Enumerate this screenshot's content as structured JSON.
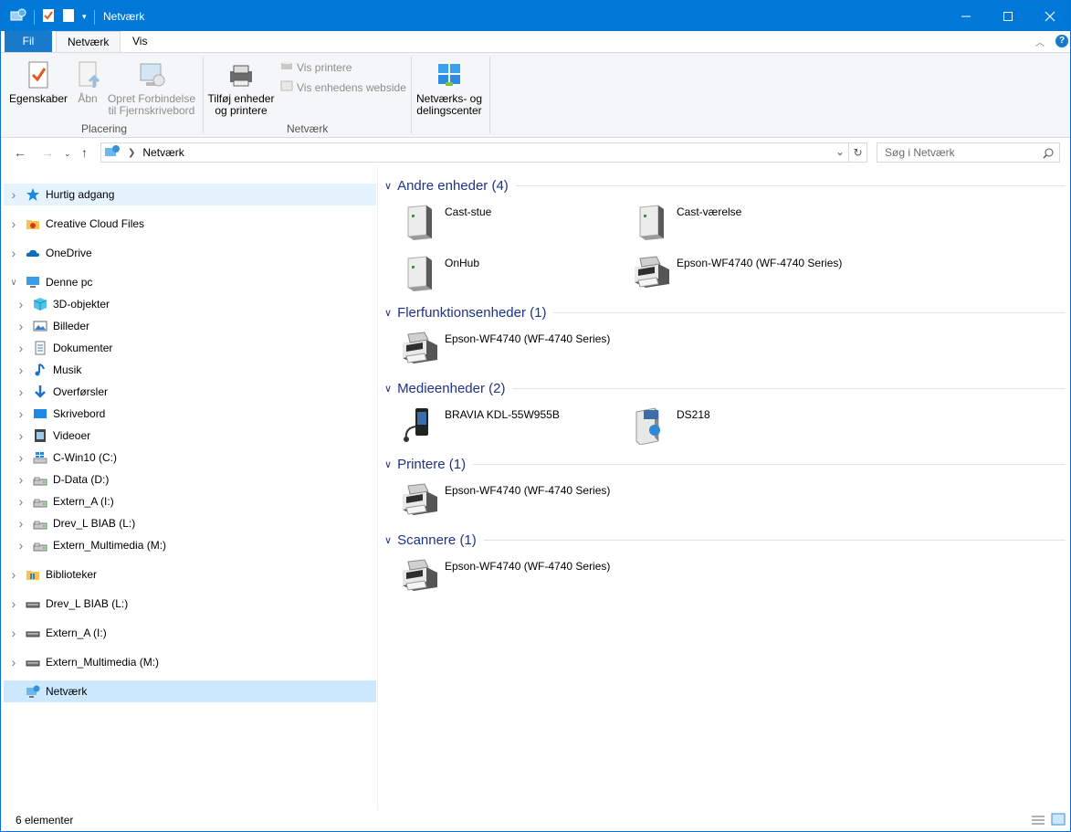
{
  "window": {
    "title": "Netværk"
  },
  "ribbon_tabs": [
    "Fil",
    "Netværk",
    "Vis"
  ],
  "ribbon": {
    "egenskaber": "Egenskaber",
    "abn": "Åbn",
    "opret1": "Opret Forbindelse",
    "opret2": "til Fjernskrivebord",
    "group_placering": "Placering",
    "tilfoej1": "Tilføj enheder",
    "tilfoej2": "og printere",
    "vis_printere": "Vis printere",
    "vis_webside": "Vis enhedens webside",
    "group_netvaerk": "Netværk",
    "center1": "Netværks- og",
    "center2": "delingscenter"
  },
  "address": {
    "path": "Netværk",
    "search_placeholder": "Søg i Netværk"
  },
  "nav": [
    {
      "label": "Hurtig adgang",
      "level": 0,
      "icon": "star-icon",
      "expand": "right",
      "state": "hover"
    },
    {
      "label": "Creative Cloud Files",
      "level": 0,
      "icon": "creative-cloud-icon",
      "expand": "right"
    },
    {
      "label": "OneDrive",
      "level": 0,
      "icon": "onedrive-icon",
      "expand": "right"
    },
    {
      "label": "Denne pc",
      "level": 0,
      "icon": "computer-icon",
      "expand": "down"
    },
    {
      "label": "3D-objekter",
      "level": 1,
      "icon": "cube-icon",
      "expand": "right"
    },
    {
      "label": "Billeder",
      "level": 1,
      "icon": "pictures-icon",
      "expand": "right"
    },
    {
      "label": "Dokumenter",
      "level": 1,
      "icon": "documents-icon",
      "expand": "right"
    },
    {
      "label": "Musik",
      "level": 1,
      "icon": "music-icon",
      "expand": "right"
    },
    {
      "label": "Overførsler",
      "level": 1,
      "icon": "download-icon",
      "expand": "right"
    },
    {
      "label": "Skrivebord",
      "level": 1,
      "icon": "desktop-icon",
      "expand": "right"
    },
    {
      "label": "Videoer",
      "level": 1,
      "icon": "video-icon",
      "expand": "right"
    },
    {
      "label": "C-Win10 (C:)",
      "level": 1,
      "icon": "windows-drive-icon",
      "expand": "right"
    },
    {
      "label": "D-Data (D:)",
      "level": 1,
      "icon": "drive-icon",
      "expand": "right"
    },
    {
      "label": "Extern_A (I:)",
      "level": 1,
      "icon": "drive-icon",
      "expand": "right"
    },
    {
      "label": "Drev_L BIAB (L:)",
      "level": 1,
      "icon": "drive-icon",
      "expand": "right"
    },
    {
      "label": "Extern_Multimedia (M:)",
      "level": 1,
      "icon": "drive-icon",
      "expand": "right"
    },
    {
      "label": "Biblioteker",
      "level": 0,
      "icon": "library-icon",
      "expand": "right"
    },
    {
      "label": "Drev_L BIAB (L:)",
      "level": 0,
      "icon": "removable-drive-icon",
      "expand": "right"
    },
    {
      "label": "Extern_A (I:)",
      "level": 0,
      "icon": "removable-drive-icon",
      "expand": "right"
    },
    {
      "label": "Extern_Multimedia (M:)",
      "level": 0,
      "icon": "removable-drive-icon",
      "expand": "right"
    },
    {
      "label": "Netværk",
      "level": 0,
      "icon": "network-icon",
      "expand": "none",
      "state": "selected"
    }
  ],
  "groups": [
    {
      "title": "Andre enheder (4)",
      "items": [
        {
          "label": "Cast-stue",
          "icon": "server-icon"
        },
        {
          "label": "Cast-værelse",
          "icon": "server-icon"
        },
        {
          "label": "OnHub",
          "icon": "server-icon"
        },
        {
          "label": "Epson-WF4740 (WF-4740 Series)",
          "icon": "printer-icon"
        }
      ]
    },
    {
      "title": "Flerfunktionsenheder (1)",
      "items": [
        {
          "label": "Epson-WF4740 (WF-4740 Series)",
          "icon": "printer-icon"
        }
      ]
    },
    {
      "title": "Medieenheder (2)",
      "items": [
        {
          "label": "BRAVIA KDL-55W955B",
          "icon": "media-player-icon"
        },
        {
          "label": "DS218",
          "icon": "media-server-icon"
        }
      ]
    },
    {
      "title": "Printere (1)",
      "items": [
        {
          "label": "Epson-WF4740 (WF-4740 Series)",
          "icon": "printer-icon"
        }
      ]
    },
    {
      "title": "Scannere (1)",
      "items": [
        {
          "label": "Epson-WF4740 (WF-4740 Series)",
          "icon": "printer-icon"
        }
      ]
    }
  ],
  "status": {
    "count": "6 elementer"
  }
}
